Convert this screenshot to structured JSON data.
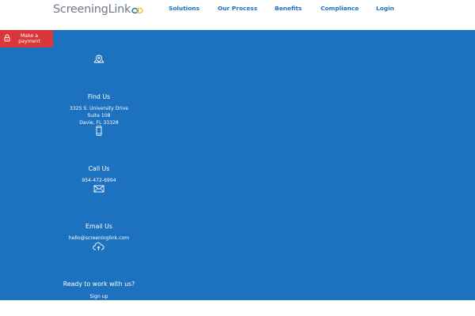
{
  "brand": {
    "logo_text": "ScreeningLink",
    "logo_icon": "infinity-link-icon"
  },
  "nav": {
    "items": [
      {
        "label": "Solutions"
      },
      {
        "label": "Our Process"
      },
      {
        "label": "Benefits"
      },
      {
        "label": "Compliance"
      },
      {
        "label": "Login"
      }
    ]
  },
  "payment": {
    "label": "Make a payment",
    "icon": "lock-icon"
  },
  "contact": {
    "find": {
      "icon": "map-marker-icon",
      "title": "Find Us",
      "address": [
        "3325 S. University Drive",
        "Suite 108",
        "Davie, FL 33328"
      ]
    },
    "call": {
      "icon": "mobile-phone-icon",
      "title": "Call Us",
      "phone": "954-472-6994"
    },
    "email": {
      "icon": "envelope-icon",
      "title": "Email Us",
      "address": "hello@screeninglink.com"
    },
    "cta": {
      "icon": "cloud-upload-icon",
      "title": "Ready to work with us?",
      "signup_label": "Sign up"
    }
  },
  "colors": {
    "brand_blue": "#1d72bf",
    "nav_text": "#1e6fbf",
    "payment_red": "#d9373a",
    "logo_gray": "#6e7a86",
    "logo_yellow": "#f2c32a"
  }
}
